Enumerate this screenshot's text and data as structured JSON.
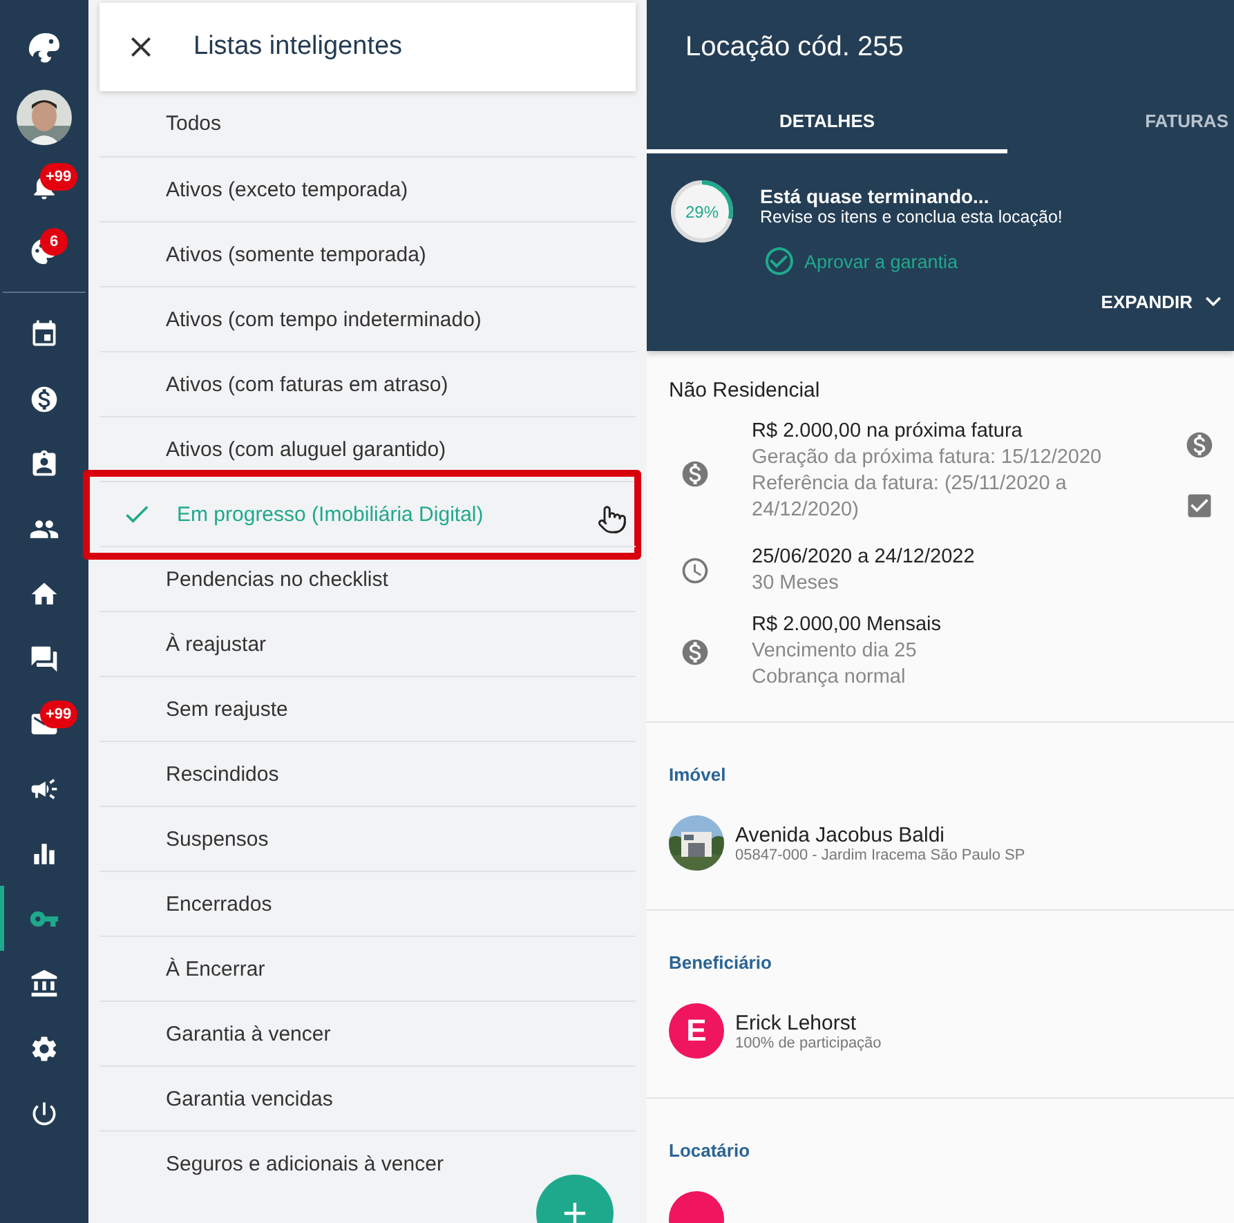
{
  "sidebar": {
    "items": [
      {
        "kind": "logo",
        "selected": false
      },
      {
        "kind": "avatar",
        "selected": false
      },
      {
        "kind": "icon",
        "badge": "+99",
        "selected": false
      },
      {
        "kind": "icon",
        "badge": "6",
        "selected": false
      },
      {
        "kind": "divider"
      },
      {
        "kind": "icon",
        "selected": false
      },
      {
        "kind": "icon",
        "selected": false
      },
      {
        "kind": "icon",
        "selected": false
      },
      {
        "kind": "icon",
        "selected": false
      },
      {
        "kind": "icon",
        "selected": false
      },
      {
        "kind": "icon",
        "selected": false
      },
      {
        "kind": "icon",
        "badge": "+99",
        "selected": false
      },
      {
        "kind": "icon",
        "selected": false
      },
      {
        "kind": "icon",
        "selected": false
      },
      {
        "kind": "icon",
        "selected": true
      },
      {
        "kind": "icon",
        "selected": false
      },
      {
        "kind": "icon",
        "selected": false
      },
      {
        "kind": "icon",
        "selected": false
      }
    ]
  },
  "smart_lists": {
    "title": "Listas inteligentes",
    "items": [
      {
        "label": "Todos",
        "selected": false
      },
      {
        "label": "Ativos (exceto temporada)",
        "selected": false
      },
      {
        "label": "Ativos (somente temporada)",
        "selected": false
      },
      {
        "label": "Ativos (com tempo indeterminado)",
        "selected": false
      },
      {
        "label": "Ativos (com faturas em atraso)",
        "selected": false
      },
      {
        "label": "Ativos (com aluguel garantido)",
        "selected": false
      },
      {
        "label": "Em progresso (Imobiliária Digital)",
        "selected": true,
        "highlighted": true
      },
      {
        "label": "Pendencias no checklist",
        "selected": false
      },
      {
        "label": "À reajustar",
        "selected": false
      },
      {
        "label": "Sem reajuste",
        "selected": false
      },
      {
        "label": "Rescindidos",
        "selected": false
      },
      {
        "label": "Suspensos",
        "selected": false
      },
      {
        "label": "Encerrados",
        "selected": false
      },
      {
        "label": "À Encerrar",
        "selected": false
      },
      {
        "label": "Garantia à vencer",
        "selected": false
      },
      {
        "label": "Garantia vencidas",
        "selected": false
      },
      {
        "label": "Seguros e adicionais à vencer",
        "selected": false
      }
    ]
  },
  "detail": {
    "title": "Locação cód. 255",
    "tabs": [
      {
        "label": "DETALHES",
        "selected": true
      },
      {
        "label": "FATURAS",
        "selected": false
      }
    ],
    "progress": {
      "level": 0.29,
      "reading": "29%",
      "heading": "Está quase terminando...",
      "text": "Revise os itens e conclua esta locação!",
      "action": "Aprovar a garantia",
      "expand": "EXPANDIR"
    },
    "type": "Não Residencial",
    "info_rows": [
      {
        "kind": "invoice",
        "title": "R$ 2.000,00 na próxima fatura",
        "lines": [
          "Geração da próxima fatura: 15/12/2020",
          "Referência da fatura: (25/11/2020 a 24/12/2020)"
        ],
        "checked": true
      },
      {
        "kind": "period",
        "title": "25/06/2020 a 24/12/2022",
        "lines": [
          "30 Meses"
        ]
      },
      {
        "kind": "rent",
        "title": "R$ 2.000,00 Mensais",
        "lines": [
          "Vencimento dia 25",
          "Cobrança normal"
        ]
      }
    ],
    "sections": [
      {
        "heading": "Imóvel",
        "name": "Avenida Jacobus Baldi",
        "sub": "05847-000 - Jardim Iracema São Paulo SP"
      },
      {
        "heading": "Beneficiário",
        "avatar": {
          "kind": "letter",
          "letter": "E",
          "color": "#f0155f"
        },
        "name": "Erick Lehorst",
        "sub": "100% de participação"
      },
      {
        "heading": "Locatário",
        "avatar": {
          "kind": "partial",
          "color": "#f0155f"
        }
      }
    ]
  }
}
